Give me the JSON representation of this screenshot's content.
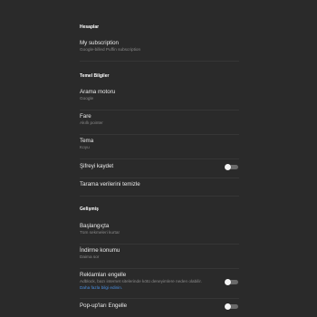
{
  "sections": {
    "accounts": {
      "header": "Hesaplar"
    },
    "basic": {
      "header": "Temel Bilgiler"
    },
    "advanced": {
      "header": "Gelişmiş"
    }
  },
  "items": {
    "subscription": {
      "title": "My subscription",
      "subtitle": "Google-billed Puffin subscription"
    },
    "search_engine": {
      "title": "Arama motoru",
      "subtitle": "Google"
    },
    "mouse": {
      "title": "Fare",
      "subtitle": "Akıllı pointer"
    },
    "theme": {
      "title": "Tema",
      "subtitle": "Koyu"
    },
    "save_password": {
      "title": "Şifreyi kaydet",
      "toggle_on": false
    },
    "clear_data": {
      "title": "Tarama verilerini temizle"
    },
    "startup": {
      "title": "Başlangıçta",
      "subtitle": "Tüm sekmeleri kurtar"
    },
    "download_location": {
      "title": "İndirme konumu",
      "subtitle": "Daima sor"
    },
    "block_ads": {
      "title": "Reklamları engelle",
      "subtitle": "Adblock, bazı internet sitelerinde kötü deneyimlere neden olabilir.",
      "link": "Daha fazla bilgi edinin.",
      "toggle_on": false
    },
    "block_popups": {
      "title": "Pop-up'ları Engelle",
      "toggle_on": false
    }
  },
  "colors": {
    "background": "#2a2a2a",
    "link": "#4a8fe0",
    "divider": "#363636"
  }
}
